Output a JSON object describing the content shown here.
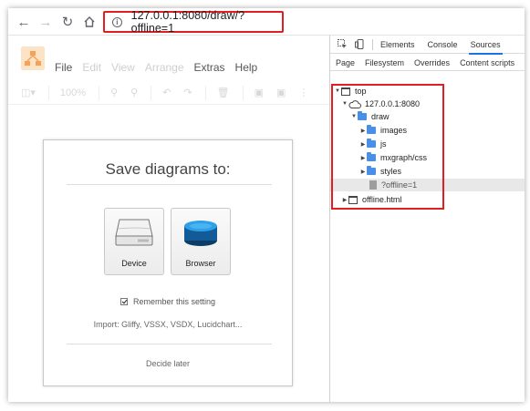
{
  "browser": {
    "url": "127.0.0.1:8080/draw/?offline=1",
    "info_glyph": "i"
  },
  "app": {
    "menu": [
      {
        "label": "File",
        "enabled": true
      },
      {
        "label": "Edit",
        "enabled": false
      },
      {
        "label": "View",
        "enabled": false
      },
      {
        "label": "Arrange",
        "enabled": false
      },
      {
        "label": "Extras",
        "enabled": true
      },
      {
        "label": "Help",
        "enabled": true
      }
    ],
    "zoom": "100%"
  },
  "dialog": {
    "title": "Save diagrams to:",
    "device_label": "Device",
    "browser_label": "Browser",
    "remember_label": "Remember this setting",
    "remember_checked": true,
    "import_text": "Import: Gliffy, VSSX, VSDX, Lucidchart...",
    "decide_later": "Decide later"
  },
  "devtools": {
    "tabs": [
      "Elements",
      "Console",
      "Sources"
    ],
    "active_tab": "Sources",
    "subtabs": [
      "Page",
      "Filesystem",
      "Overrides",
      "Content scripts"
    ],
    "active_subtab": "Page",
    "tree": {
      "top": "top",
      "origin": "127.0.0.1:8080",
      "draw": "draw",
      "folders": [
        "images",
        "js",
        "mxgraph/css",
        "styles"
      ],
      "file": "?offline=1",
      "offline": "offline.html"
    }
  },
  "colors": {
    "highlight_border": "#e02020",
    "folder": "#4a8fe7",
    "active_tab": "#1a73e8",
    "logo_bg": "#fce3c5",
    "logo_fg": "#f4a259"
  }
}
